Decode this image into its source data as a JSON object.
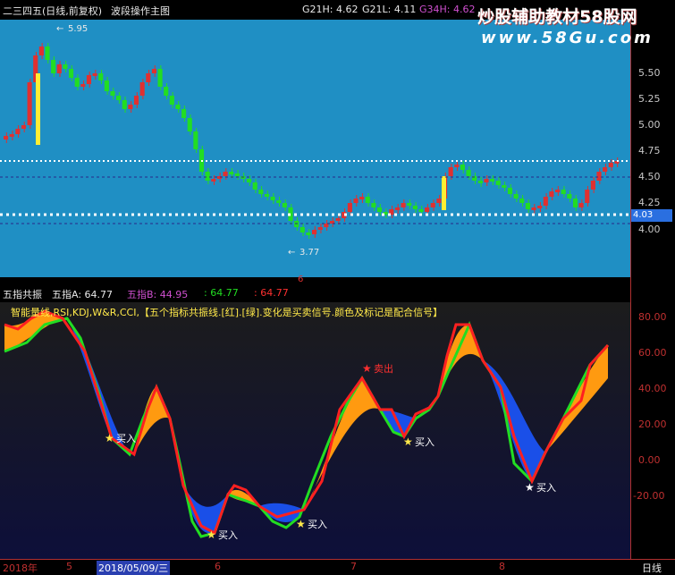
{
  "header": {
    "title": "二三四五(日线,前复权)",
    "mode": "波段操作主图",
    "g21h": "G21H: 4.62",
    "g21l": "G21L: 4.11",
    "g34h": "G34H: 4.62"
  },
  "watermark": {
    "line1": "炒股辅助教材58股网",
    "line2": "www.58Gu.com"
  },
  "main_chart": {
    "high_label": "5.95",
    "low_label": "3.77",
    "price_tag": "4.03",
    "y_ticks": [
      "5.50",
      "5.25",
      "5.00",
      "4.75",
      "4.50",
      "4.25",
      "4.00"
    ],
    "marker": "6"
  },
  "indicator": {
    "name": "五指共振",
    "a": "五指A: 64.77",
    "b": "五指B: 44.95",
    "c": ": 64.77",
    "d": ": 64.77",
    "desc": "智能量线,RSI,KDJ,W&R,CCI,【五个指标共振线.[红].[绿].变化是买卖信号.颜色及标记是配合信号】",
    "signals": {
      "buy": "买入",
      "sell": "卖出"
    },
    "y_ticks": [
      "80.00",
      "60.00",
      "40.00",
      "20.00",
      "0.00",
      "-20.00"
    ]
  },
  "bottom_bar": {
    "year": "2018年",
    "m5": "5",
    "date": "2018/05/09/三",
    "m6": "6",
    "m7": "7",
    "m8": "8",
    "period": "日线"
  },
  "colors": {
    "main_bg": "#1f8fc4",
    "up_candle": "#e03030",
    "down_candle": "#22dd22",
    "accent_yellow": "#ffee33",
    "indicator_red": "#ff2020",
    "indicator_green": "#22dd22",
    "fill_orange": "#ff9a10",
    "fill_blue": "#1a4fe8"
  }
}
